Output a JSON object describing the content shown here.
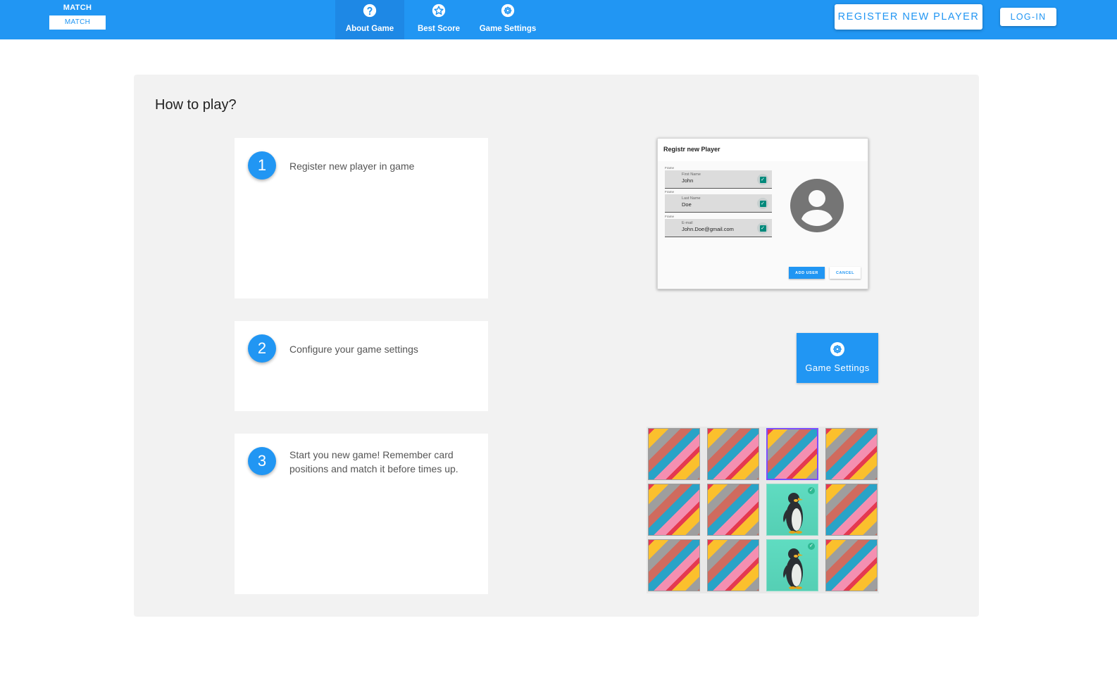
{
  "app": {
    "logo_top": "MATCH",
    "logo_bottom": "MATCH"
  },
  "nav": {
    "items": [
      {
        "label": "About Game",
        "icon": "help-circle-icon",
        "active": true
      },
      {
        "label": "Best Score",
        "icon": "star-outline-icon",
        "active": false
      },
      {
        "label": "Game Settings",
        "icon": "gear-icon",
        "active": false
      }
    ]
  },
  "header": {
    "register_label": "REGISTER NEW PLAYER",
    "login_label": "LOG-IN"
  },
  "main": {
    "title": "How to play?",
    "steps": [
      {
        "number": "1",
        "text": "Register new player in game"
      },
      {
        "number": "2",
        "text": "Configure your game settings"
      },
      {
        "number": "3",
        "text": "Start you new game! Remember card positions and match it before times up."
      }
    ]
  },
  "register_preview": {
    "title": "Registr new Player",
    "fields": [
      {
        "caption": "Frame",
        "label": "First Name",
        "value": "John"
      },
      {
        "caption": "Frame",
        "label": "Last Name",
        "value": "Doe"
      },
      {
        "caption": "Frame",
        "label": "E-mail",
        "value": "John.Doe@gmail.com"
      }
    ],
    "add_label": "ADD USER",
    "cancel_label": "CANCEL"
  },
  "settings_preview": {
    "label": "Game Settings",
    "icon": "gear-icon"
  },
  "board_preview": {
    "rows": 3,
    "cols": 4,
    "cards": [
      "back",
      "back",
      "selected",
      "back",
      "back",
      "back",
      "found",
      "back",
      "back",
      "back",
      "found",
      "back"
    ]
  },
  "colors": {
    "primary": "#2196f3",
    "panel_bg": "#f2f2f2",
    "found_card": "#5fdcc1",
    "selected_border": "#7c4dff"
  }
}
